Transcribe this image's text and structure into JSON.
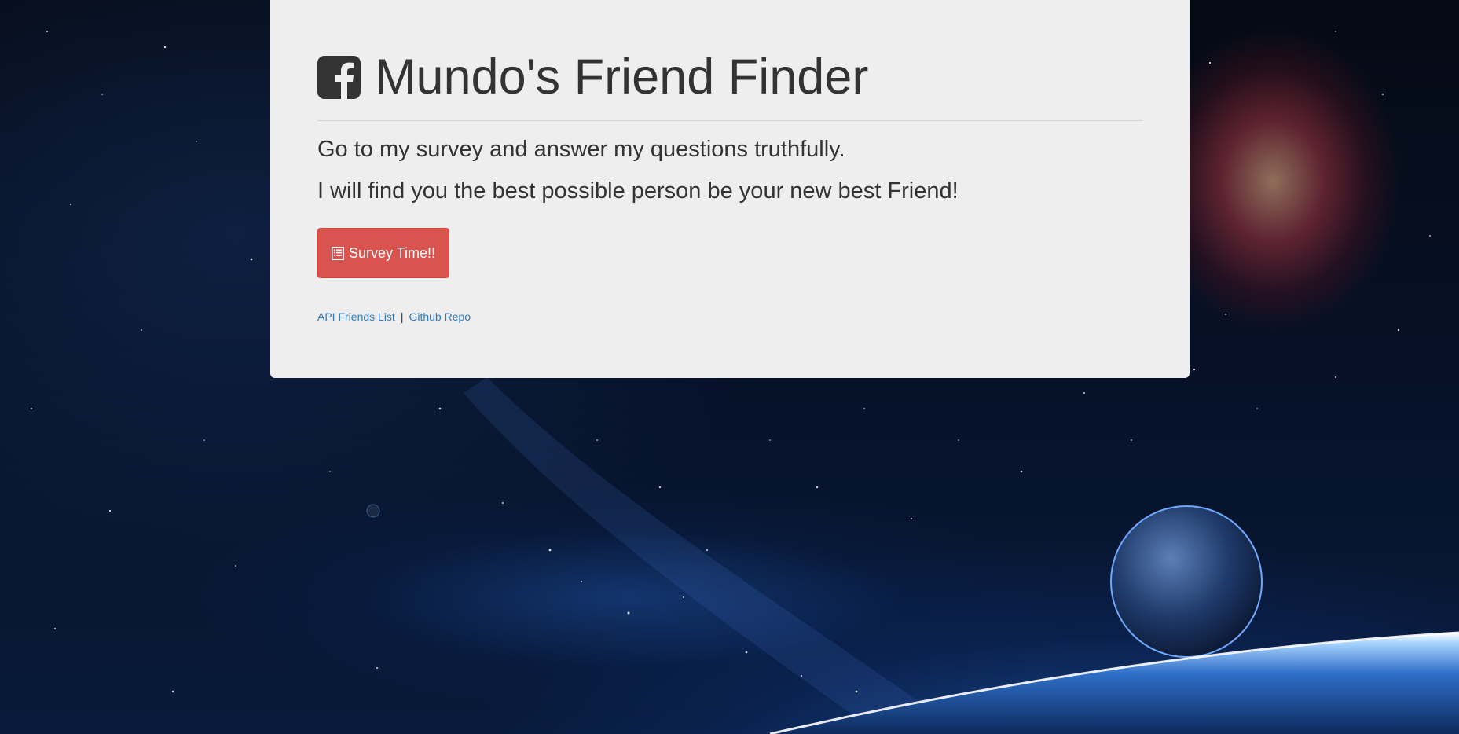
{
  "page": {
    "title": "Mundo's Friend Finder",
    "lead_line_1": "Go to my survey and answer my questions truthfully.",
    "lead_line_2": "I will find you the best possible person be your new best Friend!",
    "survey_button_label": "Survey Time!!",
    "links": {
      "api_friends_list": "API Friends List",
      "separator": "|",
      "github_repo": "Github Repo"
    }
  },
  "icons": {
    "title_icon": "facebook-square-icon",
    "button_icon": "list-alt-icon"
  },
  "colors": {
    "jumbotron_bg": "#eeeeee",
    "button_danger": "#d9534f",
    "link": "#337ab7",
    "text": "#333333"
  }
}
